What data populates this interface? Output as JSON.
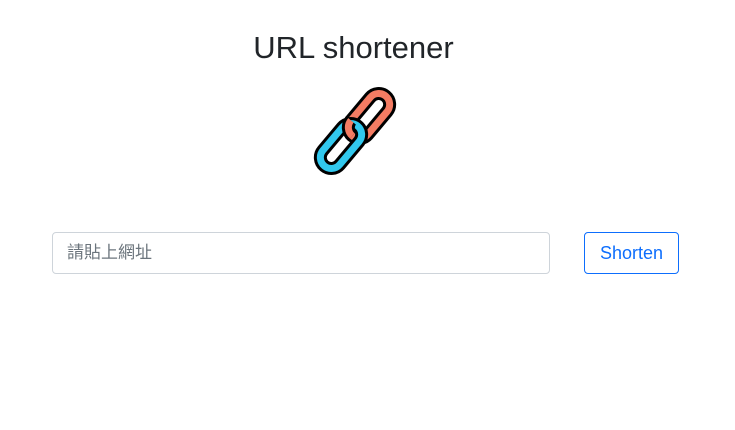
{
  "header": {
    "title": "URL shortener",
    "logo_icon": "link-icon"
  },
  "form": {
    "url_placeholder": "請貼上網址",
    "url_value": "",
    "shorten_label": "Shorten"
  },
  "colors": {
    "accent": "#0d6efd",
    "link_red": "#f47c63",
    "link_blue": "#31c8ee",
    "border": "#ced4da"
  }
}
